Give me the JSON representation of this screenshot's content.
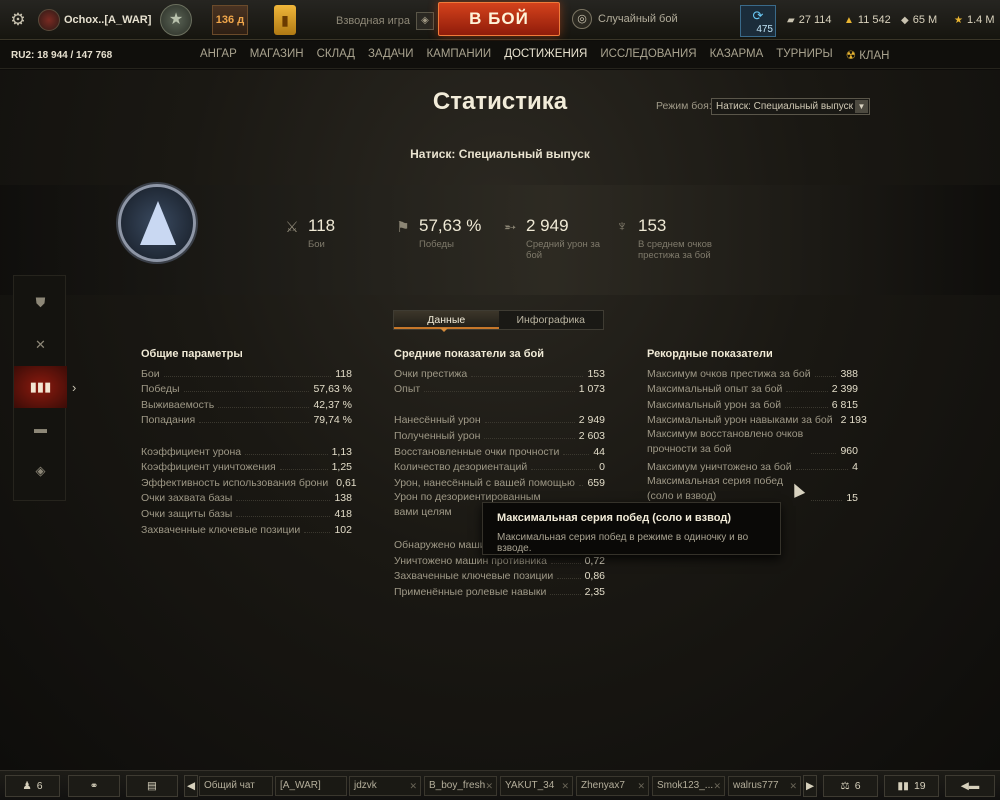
{
  "header": {
    "player_name": "Ochox..[A_WAR]",
    "level": "136",
    "level_suffix": "д",
    "platoon_label": "Взводная игра",
    "battle_button": "В БОЙ",
    "battle_mode": "Случайный бой",
    "free_xp_count": "475",
    "currencies": [
      {
        "icon": "credits-icon",
        "value": "27 114"
      },
      {
        "icon": "gold-icon",
        "value": "11 542"
      },
      {
        "icon": "crystal-icon",
        "value": "65 M"
      },
      {
        "icon": "star-icon",
        "value": "1.4 M"
      }
    ]
  },
  "nav": {
    "server_info": "RU2: 18 944  /  147 768",
    "items": [
      "АНГАР",
      "МАГАЗИН",
      "СКЛАД",
      "ЗАДАЧИ",
      "КАМПАНИИ",
      "ДОСТИЖЕНИЯ",
      "ИССЛЕДОВАНИЯ",
      "КАЗАРМА",
      "ТУРНИРЫ",
      "КЛАН"
    ],
    "active": "ДОСТИЖЕНИЯ"
  },
  "page": {
    "title": "Статистика",
    "battle_mode_label": "Режим боя:",
    "battle_mode_value": "Натиск: Специальный выпуск",
    "subtitle": "Натиск: Специальный выпуск"
  },
  "kpis": [
    {
      "icon": "swords-icon",
      "value": "118",
      "label": "Бои"
    },
    {
      "icon": "flag-icon",
      "value": "57,63 %",
      "label": "Победы"
    },
    {
      "icon": "shell-icon",
      "value": "2 949",
      "label": "Средний урон за бой"
    },
    {
      "icon": "prestige-icon",
      "value": "153",
      "label": "В среднем очков престижа за бой"
    }
  ],
  "tabs": [
    "Данные",
    "Инфографика"
  ],
  "active_tab": "Данные",
  "columns": {
    "general": {
      "title": "Общие параметры",
      "rows": [
        {
          "label": "Бои",
          "value": "118"
        },
        {
          "label": "Победы",
          "value": "57,63 %"
        },
        {
          "label": "Выживаемость",
          "value": "42,37 %"
        },
        {
          "label": "Попадания",
          "value": "79,74 %"
        },
        {
          "label": "",
          "value": ""
        },
        {
          "label": "Коэффициент урона",
          "value": "1,13"
        },
        {
          "label": "Коэффициент уничтожения",
          "value": "1,25"
        },
        {
          "label": "Эффективность использования брони",
          "value": "0,61"
        },
        {
          "label": "Очки захвата базы",
          "value": "138"
        },
        {
          "label": "Очки защиты базы",
          "value": "418"
        },
        {
          "label": "Захваченные ключевые позиции",
          "value": "102"
        }
      ]
    },
    "average": {
      "title": "Средние показатели за бой",
      "rows": [
        {
          "label": "Очки престижа",
          "value": "153"
        },
        {
          "label": "Опыт",
          "value": "1 073"
        },
        {
          "label": "",
          "value": ""
        },
        {
          "label": "Нанесённый урон",
          "value": "2 949"
        },
        {
          "label": "Полученный урон",
          "value": "2 603"
        },
        {
          "label": "Восстановленные очки прочности",
          "value": "44"
        },
        {
          "label": "Количество дезориентаций",
          "value": "0"
        },
        {
          "label": "Урон, нанесённый с вашей помощью",
          "value": "659"
        },
        {
          "label": "Урон по дезориентированным вами целям",
          "value": "",
          "two_line": true
        },
        {
          "label": "",
          "value": ""
        },
        {
          "label": "Обнаружено машин",
          "value": ""
        },
        {
          "label": "Уничтожено машин противника",
          "value": "0,72"
        },
        {
          "label": "Захваченные ключевые позиции",
          "value": "0,86"
        },
        {
          "label": "Применённые ролевые навыки",
          "value": "2,35"
        }
      ]
    },
    "records": {
      "title": "Рекордные показатели",
      "rows": [
        {
          "label": "Максимум очков престижа за бой",
          "value": "388"
        },
        {
          "label": "Максимальный опыт за бой",
          "value": "2 399"
        },
        {
          "label": "Максимальный урон за бой",
          "value": "6 815"
        },
        {
          "label": "Максимальный урон навыками за бой",
          "value": "2 193"
        },
        {
          "label": "Максимум восстановлено очков прочности за бой",
          "value": "960",
          "two_line": true
        },
        {
          "label": "Максимум уничтожено за бой",
          "value": "4"
        },
        {
          "label": "Максимальная серия побед (соло и взвод)",
          "value": "15",
          "two_line": true
        }
      ]
    }
  },
  "tooltip": {
    "title": "Максимальная серия побед (соло и взвод)",
    "body": "Максимальная серия побед в режиме в одиночку и во взводе."
  },
  "bottom": {
    "online_friends": "6",
    "chat_tabs": [
      "Общий чат",
      "[A_WAR]",
      "jdzvk",
      "B_boy_fresh",
      "YAKUT_34",
      "Zhenyax7",
      "Smok123_...",
      "walrus777"
    ],
    "fines_count": "6",
    "stats_count": "19"
  }
}
